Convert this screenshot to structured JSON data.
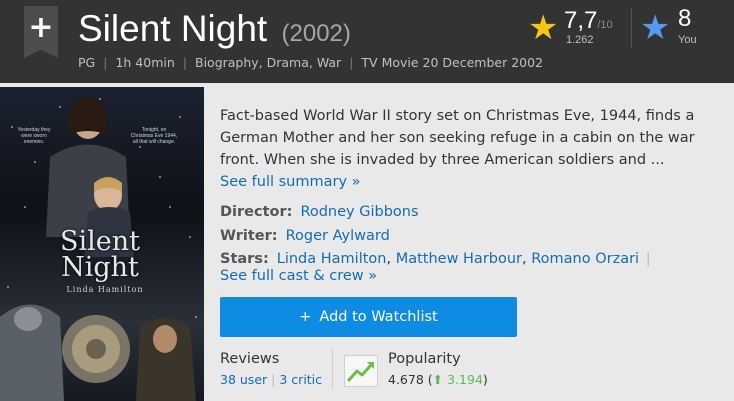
{
  "header": {
    "title": "Silent Night",
    "year": "(2002)",
    "meta": {
      "certificate": "PG",
      "runtime": "1h 40min",
      "genres": "Biography, Drama, War",
      "release": "TV Movie 20 December 2002"
    }
  },
  "rating": {
    "value": "7,7",
    "max": "/10",
    "count": "1.262",
    "star_color": "#f5c518"
  },
  "your_rating": {
    "value": "8",
    "label": "You",
    "star_color": "#5799ef"
  },
  "poster": {
    "title_line1": "Silent",
    "title_line2": "Night",
    "credit": "Linda Hamilton",
    "tag_left": "Yesterday they were sworn enemies.",
    "tag_right": "Tonight, on Christmas Eve 1944, all that will change."
  },
  "plot": {
    "text": "Fact-based World War II story set on Christmas Eve, 1944, finds a German Mother and her son seeking refuge in a cabin on the war front. When she is invaded by three American soldiers and ...",
    "see_full": "See full summary",
    "arrow": "»"
  },
  "credits": {
    "director_label": "Director:",
    "director": "Rodney Gibbons",
    "writer_label": "Writer:",
    "writer": "Roger Aylward",
    "stars_label": "Stars:",
    "stars": [
      "Linda Hamilton",
      "Matthew Harbour",
      "Romano Orzari"
    ],
    "see_cast": "See full cast & crew",
    "arrow": "»"
  },
  "watchlist": {
    "plus": "+",
    "label": "Add to Watchlist",
    "color": "#0e8ce4"
  },
  "reviews": {
    "title": "Reviews",
    "user": "38 user",
    "critic": "3 critic"
  },
  "popularity": {
    "title": "Popularity",
    "value": "4.678",
    "delta": "3.194",
    "delta_arrow": "⬆",
    "delta_color": "#5cb85c"
  },
  "icons": {
    "add": "plus-ribbon-icon",
    "rating": "star-icon",
    "popularity": "trend-up-icon"
  }
}
